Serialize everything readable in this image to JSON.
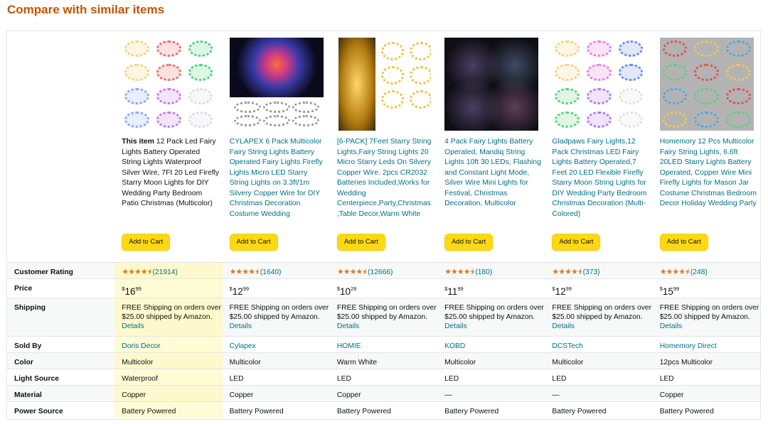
{
  "heading": "Compare with similar items",
  "this_item_label": "This item",
  "add_to_cart": "Add to Cart",
  "row_labels": {
    "rating": "Customer Rating",
    "price": "Price",
    "shipping": "Shipping",
    "sold_by": "Sold By",
    "color": "Color",
    "light_source": "Light Source",
    "material": "Material",
    "power_source": "Power Source"
  },
  "shipping_text": "FREE Shipping on orders over $25.00 shipped by Amazon.",
  "details_link": "Details",
  "products": [
    {
      "title": "12 Pack Led Fairy Lights Battery Operated String Lights Waterproof Silver Wire, 7Ft 20 Led Firefly Starry Moon Lights for DIY Wedding Party Bedroom Patio Christmas (Multicolor)",
      "stars": "★★★★⯨",
      "rating_count": "(21914)",
      "price_dollars": "16",
      "price_cents": "99",
      "sold_by": "Doris Decor",
      "color": "Multicolor",
      "light_source": "Waterproof",
      "material": "Copper",
      "power_source": "Battery Powered",
      "image_style": "light-grid",
      "coil_colors": [
        "#f3d27a",
        "#f06a6a",
        "#4cd17a",
        "#f3d27a",
        "#f06a6a",
        "#4cd17a",
        "#8aa8f0",
        "#c07ae8",
        "#dcdce8",
        "#8aa8f0",
        "#c07ae8",
        "#dcdce8"
      ]
    },
    {
      "title": "CYLAPEX 6 Pack Multicolor Fairy String Lights Battery Operated Fairy Lights Firefly Lights Micro LED Starry String Lights on 3.3ft/1m Silvery Copper Wire for DIY Christmas Decoration Costume Wedding",
      "stars": "★★★★⯨",
      "rating_count": "(1640)",
      "price_dollars": "12",
      "price_cents": "99",
      "sold_by": "Cylapex",
      "color": "Multicolor",
      "light_source": "LED",
      "material": "Copper",
      "power_source": "Battery Powered",
      "image_style": "dark-top"
    },
    {
      "title": "[6-PACK] 7Feet Starry String Lights,Fairy String Lights 20 Micro Starry Leds On Silvery Copper Wire. 2pcs CR2032 Batteries Included,Works for Wedding Centerpiece,Party,Christmas ,Table Decor,Warm White",
      "stars": "★★★★⯨",
      "rating_count": "(12666)",
      "price_dollars": "10",
      "price_cents": "28",
      "sold_by": "HOMIE",
      "color": "Warm White",
      "light_source": "LED",
      "material": "Copper",
      "power_source": "Battery Powered",
      "image_style": "jar-warm"
    },
    {
      "title": "4 Pack Fairy Lights Battery Operated, Mandiq String Lights 10ft 30 LEDs, Flashing and Constant Light Mode, Silver Wire Mini Lights for Festival, Christmas Decoration, Multicolor",
      "stars": "★★★★⯨",
      "rating_count": "(180)",
      "price_dollars": "11",
      "price_cents": "99",
      "sold_by": "KOBD",
      "color": "Multicolor",
      "light_source": "LED",
      "material": "—",
      "power_source": "Battery Powered",
      "image_style": "dark-purple"
    },
    {
      "title": "Gladpaws Fairy Lights,12 Pack Christmas LED Fairy Lights Battery Operated,7 Feet 20 LED Flexible Firefly Starry Moon String Lights for DIY Wedding Party Bedroom Christmas Decoration (Multi-Colored)",
      "stars": "★★★★⯨",
      "rating_count": "(373)",
      "price_dollars": "12",
      "price_cents": "99",
      "sold_by": "DCSTech",
      "color": "Multicolor",
      "light_source": "LED",
      "material": "—",
      "power_source": "Battery Powered",
      "image_style": "light-grid",
      "coil_colors": [
        "#f3d27a",
        "#f07ad8",
        "#6a8af0",
        "#f3d27a",
        "#f07ad8",
        "#6a8af0",
        "#5ad07a",
        "#b07ae8",
        "#e0e0e8",
        "#5ad07a",
        "#b07ae8",
        "#e0e0e8"
      ]
    },
    {
      "title": "Homemory 12 Pcs Multicolor Fairy String Lights, 6.6ft 20LED Starry Lights Battery Operated, Copper Wire Mini Firefly Lights for Mason Jar Costume Christmas Bedroom Decor Holiday Wedding Party",
      "stars": "★★★★⯨",
      "rating_count": "(248)",
      "price_dollars": "15",
      "price_cents": "99",
      "sold_by": "Homemory Direct",
      "color": "12pcs Multicolor",
      "light_source": "LED",
      "material": "Copper",
      "power_source": "Battery Powered",
      "image_style": "gray-grid"
    }
  ]
}
